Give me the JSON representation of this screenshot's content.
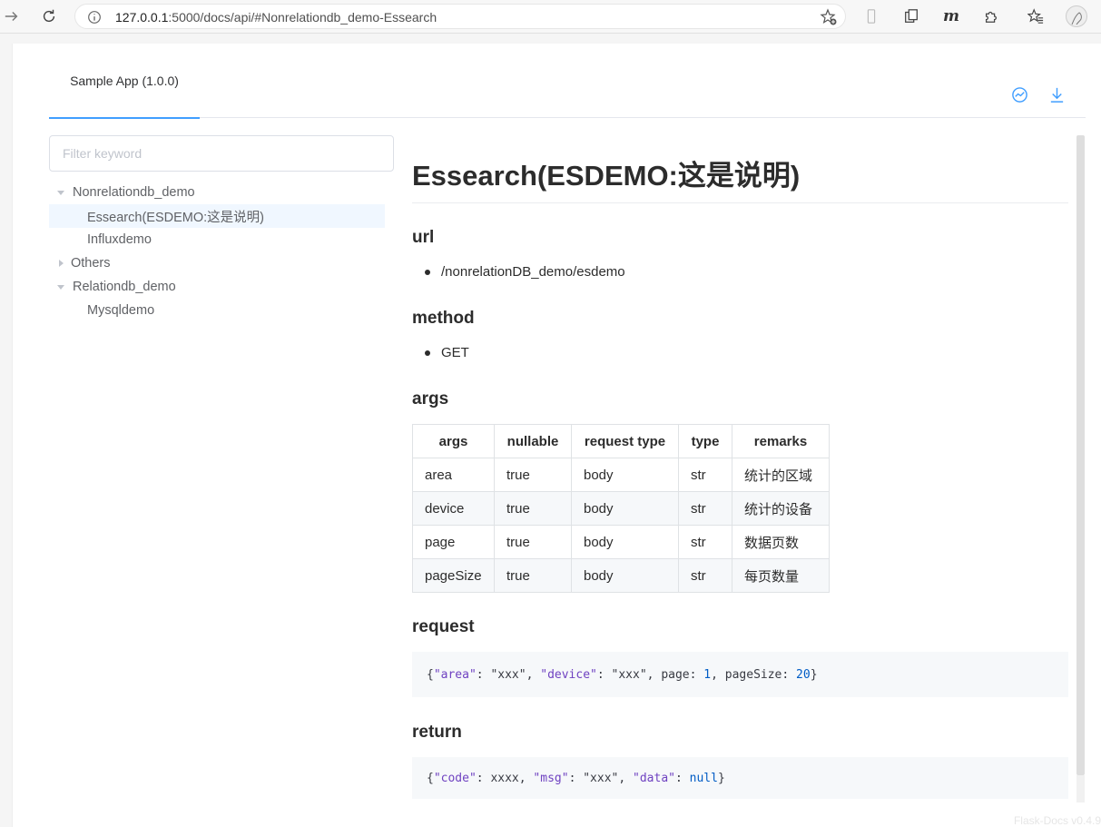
{
  "browser": {
    "url_host": "127.0.0.1",
    "url_rest": ":5000/docs/api/#Nonrelationdb_demo-Essearch"
  },
  "tabs": [
    {
      "label": "Sample App (1.0.0)"
    }
  ],
  "sidebar": {
    "filter_placeholder": "Filter keyword",
    "groups": [
      {
        "label": "Nonrelationdb_demo",
        "expanded": true,
        "children": [
          "Essearch(ESDEMO:这是说明)",
          "Influxdemo"
        ]
      },
      {
        "label": "Others",
        "expanded": false,
        "children": []
      },
      {
        "label": "Relationdb_demo",
        "expanded": true,
        "children": [
          "Mysqldemo"
        ]
      }
    ]
  },
  "main": {
    "title": "Essearch(ESDEMO:这是说明)",
    "url_heading": "url",
    "url_value": "/nonrelationDB_demo/esdemo",
    "method_heading": "method",
    "method_value": "GET",
    "args_heading": "args",
    "args_table": {
      "headers": [
        "args",
        "nullable",
        "request type",
        "type",
        "remarks"
      ],
      "rows": [
        [
          "area",
          "true",
          "body",
          "str",
          "统计的区域"
        ],
        [
          "device",
          "true",
          "body",
          "str",
          "统计的设备"
        ],
        [
          "page",
          "true",
          "body",
          "str",
          "数据页数"
        ],
        [
          "pageSize",
          "true",
          "body",
          "str",
          "每页数量"
        ]
      ]
    },
    "request_heading": "request",
    "request_code": {
      "open": "{",
      "k1": "\"area\"",
      "p1": ": \"xxx\", ",
      "k2": "\"device\"",
      "p2": ": \"xxx\", page: ",
      "n1": "1",
      "p3": ", pageSize: ",
      "n2": "20",
      "close": "}"
    },
    "return_heading": "return",
    "return_code": {
      "open": "{",
      "k1": "\"code\"",
      "p1": ": xxxx, ",
      "k2": "\"msg\"",
      "p2": ": \"xxx\", ",
      "k3": "\"data\"",
      "p3": ": ",
      "n1": "null",
      "close": "}"
    }
  },
  "footer": {
    "brand": "Flask-Docs v0.4.9"
  },
  "colors": {
    "accent": "#409eff",
    "selected_bg": "#f0f7ff"
  }
}
